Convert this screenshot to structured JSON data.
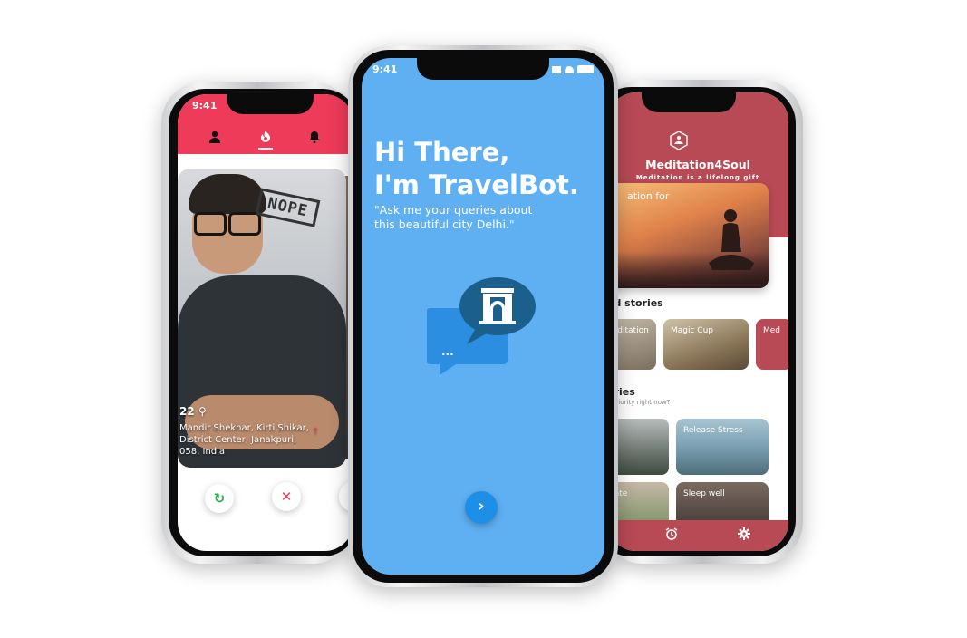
{
  "left_phone": {
    "status_time": "9:41",
    "tabs": [
      "profile-icon",
      "flame-icon",
      "bell-icon"
    ],
    "card": {
      "stamp": "NOPE",
      "age": "22",
      "location_line1": "Mandir Shekhar, Kirti Shikar,",
      "location_line2": "District Center, Janakpuri,",
      "location_line3": "058, India"
    },
    "actions": {
      "rewind": "↻",
      "dislike": "✕"
    },
    "colors": {
      "brand": "#ee3b5a"
    }
  },
  "center_phone": {
    "status_time": "9:41",
    "greeting_line1": "Hi There,",
    "greeting_line2": "I'm TravelBot.",
    "quote_line1": "\"Ask me your queries about",
    "quote_line2": "this beautiful city Delhi.\"",
    "chat_bubble_text": "...",
    "next_button": "›",
    "colors": {
      "background": "#5fb0f2",
      "button": "#1e8fe6"
    }
  },
  "right_phone": {
    "app_title": "Meditation4Soul",
    "tagline": "Meditation is a lifelong gift",
    "hero_text": "ation for",
    "sections": {
      "featured": "ed stories",
      "priority_title": "ories",
      "priority_sub": "r priority right now?"
    },
    "featured_tiles": [
      "Meditation",
      "Magic Cup",
      "Med"
    ],
    "priority_tiles": [
      "",
      "Release Stress",
      "rate",
      "Sleep well"
    ],
    "bottom_nav": [
      "alarm-icon",
      "settings-icon"
    ],
    "colors": {
      "brand": "#b84a55"
    }
  }
}
